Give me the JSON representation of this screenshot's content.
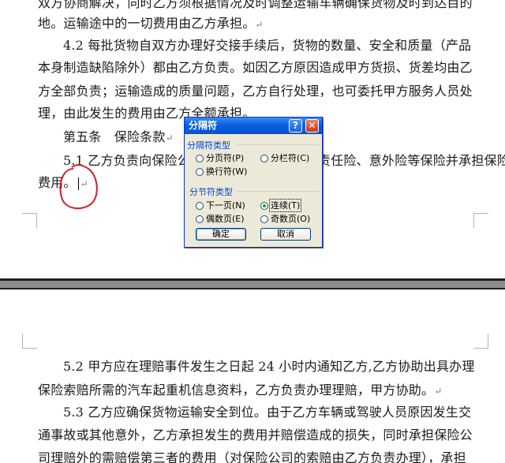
{
  "document": {
    "page1_lines": [
      "双方协商解决，同时乙方须根据情况及时调整运输车辆确保货物及时到达目的",
      "地。运输途中的一切费用由乙方承担。",
      "4.2 每批货物自双方办理好交接手续后，货物的数量、安全和质量（产品",
      "本身制造缺陷除外）都由乙方负责。如因乙方原因造成甲方货损、货差均由乙",
      "方全部负责；运输造成的质量问题，乙方自行处理，也可委托甲方服务人员处",
      "理，由此发生的费用由乙方全额承担。",
      "第五条　保险条款",
      "5.1 乙方负责向保险公司投保运输险、第三者责任险、意外险等保险并承担保险",
      "费用。"
    ],
    "page2_lines": [
      "5.2 甲方应在理赔事件发生之日起 24 小时内通知乙方,乙方协助出具办理",
      "保险索赔所需的汽车起重机信息资料，乙方负责办理理赔，甲方协助。",
      "5.3 乙方应确保货物运输安全到位。由于乙方车辆或驾驶人员原因发生交",
      "通事故或其他意外，乙方承担发生的费用并赔偿造成的损失，同时承担保险公",
      "司理赔外的需赔偿第三者的费用（对保险公司的索赔由乙方负责办理），承担"
    ],
    "return_mark": "↵"
  },
  "dialog": {
    "title": "分隔符",
    "help_label": "?",
    "close_label": "✕",
    "group1_title": "分隔符类型",
    "group1_options": [
      "分页符(P)",
      "分栏符(C)",
      "换行符(W)"
    ],
    "group2_title": "分节符类型",
    "group2_options": [
      "下一页(N)",
      "连续(T)",
      "偶数页(E)",
      "奇数页(O)"
    ],
    "selected": "连续(T)",
    "ok_label": "确定",
    "cancel_label": "取消"
  },
  "colors": {
    "annotation": "#d6202a",
    "title_bar": "#0a5fe0"
  }
}
